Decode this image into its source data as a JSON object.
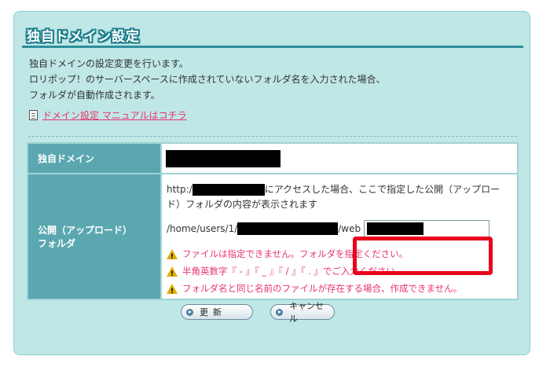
{
  "panel": {
    "title": "独自ドメイン設定",
    "description_lines": [
      "独自ドメインの設定変更を行います。",
      "ロリポップ！のサーバースペースに作成されていないフォルダ名を入力された場合、",
      "フォルダが自動作成されます。"
    ],
    "manual_link": "ドメイン設定 マニュアルはコチラ"
  },
  "form": {
    "domain_label": "独自ドメイン",
    "public_label_line1": "公開（アップロード）",
    "public_label_line2": "フォルダ",
    "url_prefix": "http:/",
    "url_text": "にアクセスした場合、ここで指定した公開（アップロード）フォルダの内容が表示されます",
    "path_prefix": "/home/users/1/",
    "path_suffix": "/web",
    "warnings": [
      "ファイルは指定できません。フォルダを指定ください。",
      "半角英数字『 - 』『 _ 』『 / 』『 . 』でご入力ください。",
      "フォルダ名と同じ名前のファイルが存在する場合、作成できません。"
    ]
  },
  "buttons": {
    "update": "更新",
    "cancel": "キャンセル"
  },
  "colors": {
    "panel_bg": "#bfe7e6",
    "header_cell": "#5aa7b0",
    "warning_text": "#e8336d",
    "highlight": "#e8001a"
  }
}
